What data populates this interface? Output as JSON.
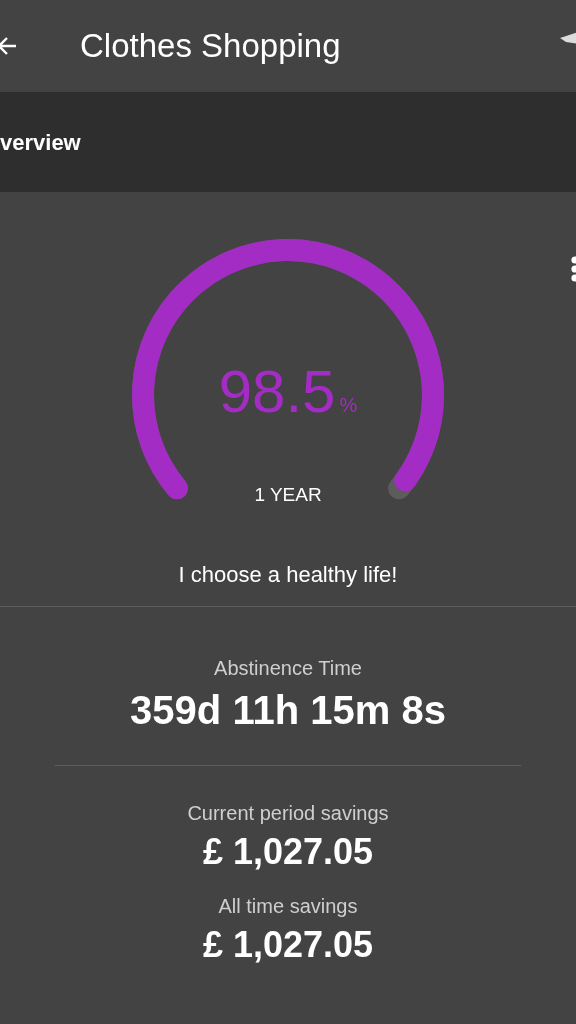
{
  "app_bar": {
    "title": "Clothes Shopping"
  },
  "tabs": [
    {
      "label": "verview"
    }
  ],
  "gauge": {
    "value": "98.5",
    "unit": "%",
    "period": "1 YEAR"
  },
  "motto": "I choose a healthy life!",
  "stats": [
    {
      "kind": "time",
      "label": "Abstinence Time",
      "value": "359d 11h 15m 8s"
    },
    {
      "kind": "money",
      "label": "Current period savings",
      "value": "£ 1,027.05"
    },
    {
      "kind": "money",
      "label": "All time savings",
      "value": "£ 1,027.05"
    }
  ]
}
